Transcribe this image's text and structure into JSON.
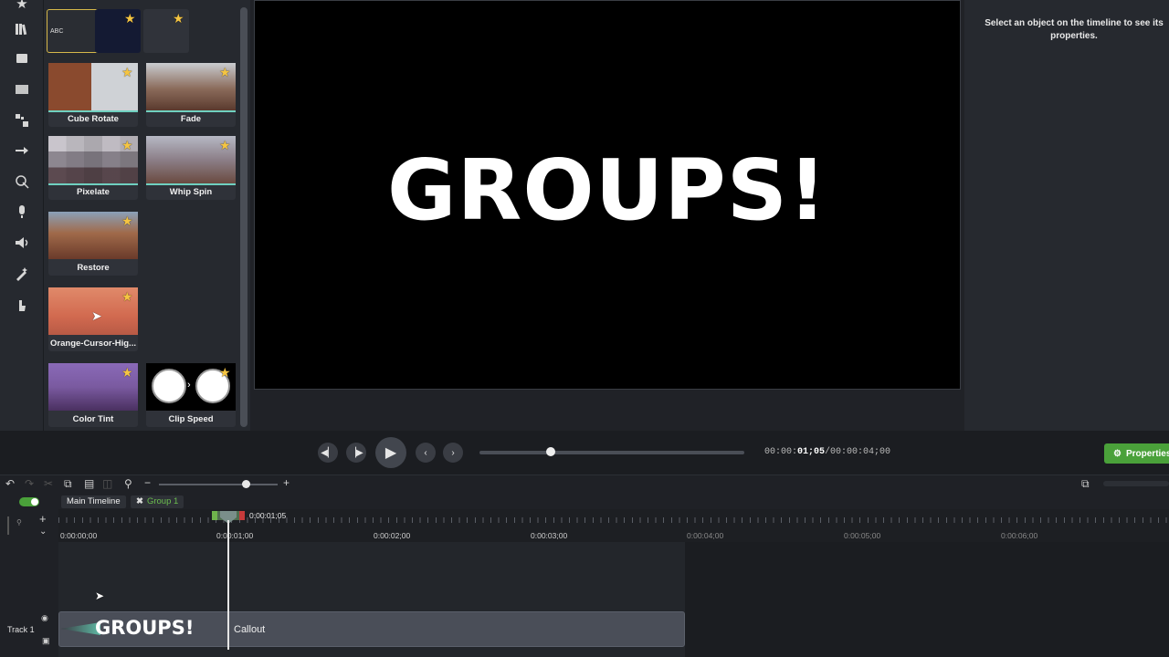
{
  "library": {
    "top_tiles": [
      {
        "label": "ABC"
      },
      {
        "label": ""
      },
      {
        "label": ""
      }
    ],
    "items": [
      {
        "label": "Cube Rotate"
      },
      {
        "label": "Fade"
      },
      {
        "label": "Pixelate"
      },
      {
        "label": "Whip Spin"
      },
      {
        "label": "Restore"
      },
      {
        "label": "Orange-Cursor-Hig..."
      },
      {
        "label": "Color Tint"
      },
      {
        "label": "Clip Speed"
      }
    ]
  },
  "canvas": {
    "text": "GROUPS!"
  },
  "properties": {
    "empty_message": "Select an object on the timeline to see its properties."
  },
  "playback": {
    "time_current_prefix": "00:00:",
    "time_current_bold": "01;05",
    "time_total": "/00:00:04;00",
    "progress": 0.27,
    "properties_button": "Properties"
  },
  "timeline": {
    "tabs": [
      "Main Timeline",
      "Group 1"
    ],
    "playhead_time": "0:00:01;05",
    "ruler_labels": [
      "0:00:00;00",
      "0:00:01;00",
      "0:00:02;00",
      "0:00:03;00",
      "0:00:04;00",
      "0:00:05;00",
      "0:00:06;00"
    ],
    "track_label": "Track 1",
    "clip_title": "GROUPS!",
    "clip_name": "Callout"
  },
  "colors": {
    "accent_green": "#4aa13a",
    "star": "#f5c542",
    "clip": "#4a4e58"
  }
}
